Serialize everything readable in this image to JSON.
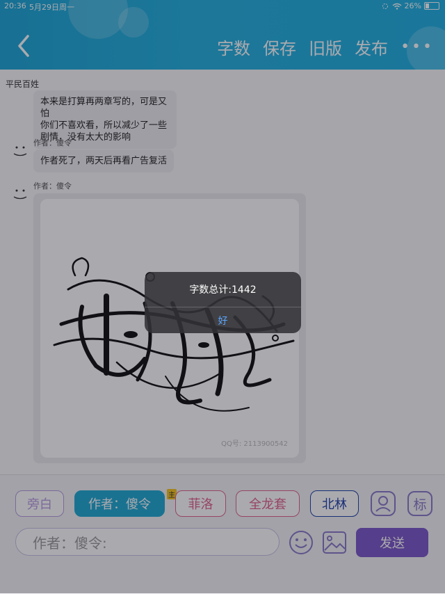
{
  "status": {
    "time": "20:36",
    "date": "5月29日周一",
    "battery": "26%",
    "battery_level": 0.26
  },
  "header": {
    "actions": [
      "字数",
      "保存",
      "旧版",
      "发布"
    ],
    "more": "•••"
  },
  "chat": {
    "title": "平民百姓",
    "messages": [
      {
        "text_line1": "本来是打算再两章写的，可是又怕",
        "text_line2": "你们不喜欢看，所以减少了一些",
        "text_line3": "剧情，没有太大的影响"
      },
      {
        "meta": "作者：傻令",
        "text": "作者死了，两天后再看广告复活"
      },
      {
        "meta": "作者：傻令"
      }
    ],
    "image_watermark": "QQ号: 2113900542"
  },
  "toolbar": {
    "chips": [
      {
        "label": "旁白",
        "color": "#b799e0"
      },
      {
        "label": "作者：傻令",
        "color": "#1ea8d2"
      },
      {
        "label": "菲洛",
        "color": "#e0608a"
      },
      {
        "label": "全龙套",
        "color": "#e0608a"
      },
      {
        "label": "北林",
        "color": "#1e3fa8"
      }
    ],
    "owner_tag": "主",
    "mark_label": "标",
    "input_value": "作者：傻令:",
    "send_label": "发送"
  },
  "alert": {
    "message": "字数总计:1442",
    "ok_label": "好"
  }
}
